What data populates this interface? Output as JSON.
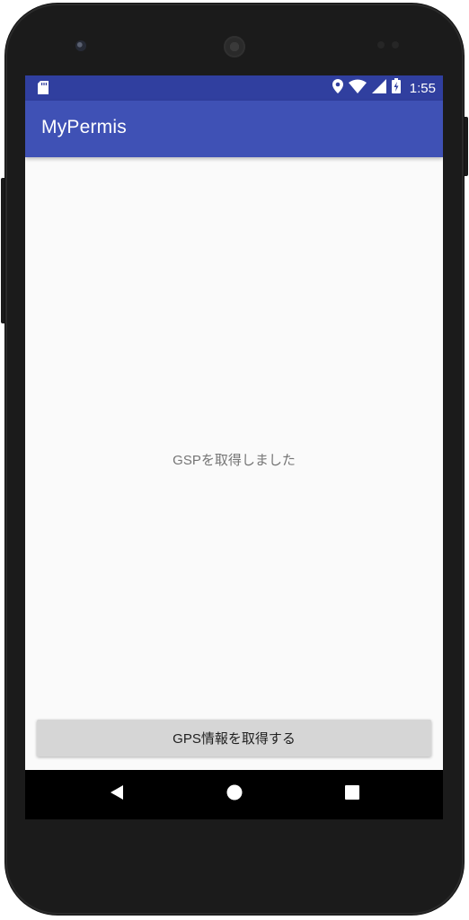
{
  "status_bar": {
    "time": "1:55",
    "color": "#303f9f"
  },
  "app_bar": {
    "title": "MyPermis",
    "color": "#3f51b5"
  },
  "content": {
    "message": "GSPを取得しました",
    "button_label": "GPS情報を取得する"
  },
  "icons": {
    "status_left": "sd-card-icon",
    "status_right": [
      "location-pin-icon",
      "wifi-icon",
      "cell-signal-icon",
      "battery-charging-icon"
    ],
    "navigation": [
      "back-icon",
      "home-icon",
      "recents-icon"
    ]
  }
}
